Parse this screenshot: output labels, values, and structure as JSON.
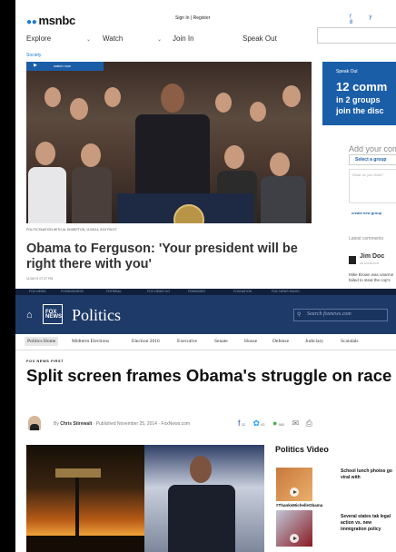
{
  "msnbc": {
    "logo": "msnbc",
    "signin": "Sign In  |  Register",
    "social": "f  y  8",
    "nav": [
      "Explore",
      "Watch",
      "Join In",
      "Speak Out"
    ],
    "section": "Society",
    "watch_now": "watch now",
    "photo_caption": "POLITICSNATION WITH AL SHARPTON, 11/26/14, 8:03 PM ET",
    "headline": "Obama to Ferguson: 'Your president will be right there with you'",
    "date": "11/26/74 07:37 PM",
    "sidebar": {
      "kicker": "Speak Out",
      "line1": "12 comm",
      "line2": "in 2 groups",
      "line3": "join the disc",
      "add_comment": "Add your com",
      "select_group": "Select a group",
      "think_placeholder": "What do you think?",
      "create_group": "create new group",
      "latest": "Latest comments",
      "comment_name": "Jim Doc",
      "comment_time": "AN HOUR AGO",
      "comment_text": "Mike Brown was unarme failed to steal the cop's"
    }
  },
  "fox": {
    "strip": [
      "FOX NEWS",
      "FOXBUSINESS",
      "FNTRIBAL",
      "FOX NEWS GO",
      "FNINSIDER",
      "FOXNATION",
      "FNC NEWS RADIO"
    ],
    "section_title": "Politics",
    "logo": "FOX NEWS",
    "search_placeholder": "Search foxnews.com",
    "subnav": [
      "Politics Home",
      "Midterm Elections",
      "Election 2016",
      "Executive",
      "Senate",
      "House",
      "Defense",
      "Judiciary",
      "Scandals"
    ],
    "kicker": "FOX NEWS FIRST",
    "headline": "Split screen frames Obama's struggle on race",
    "byline_prefix": "By",
    "author": "Chris Stirewalt",
    "published": "· Published November 25, 2014 · FoxNews.com",
    "share_counts": {
      "facebook": "32",
      "twitter": "43",
      "comments": "960"
    },
    "video_title": "Politics Video",
    "video_tag": "#ThanksMichelleObama",
    "video1": "School lunch photos go viral with",
    "video2": "Several states tak legal action vs. new immigration policy"
  }
}
